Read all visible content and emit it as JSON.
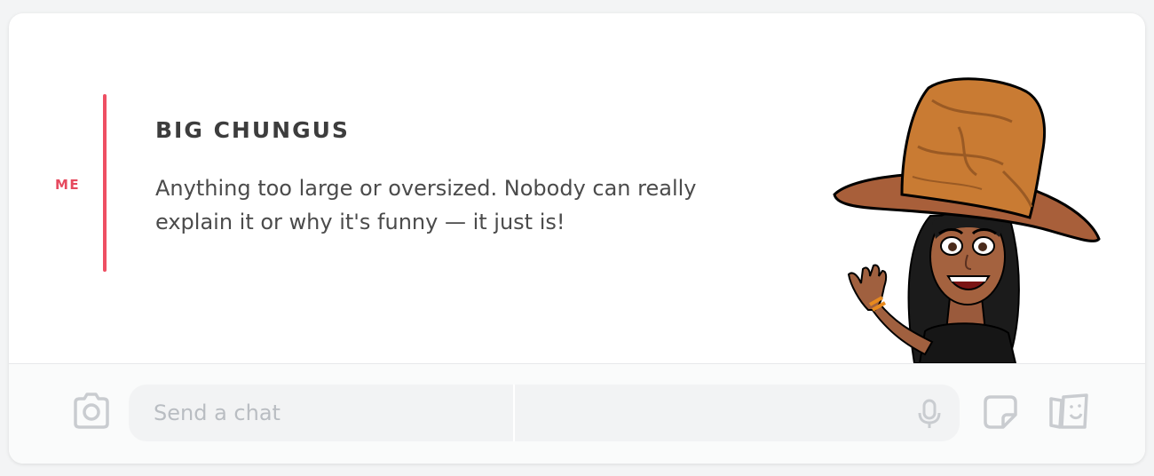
{
  "message": {
    "sender": "ME",
    "title": "BIG CHUNGUS",
    "body": "Anything too large or oversized. Nobody can really explain it or why it's funny — it just is!",
    "accent_color": "#ee4f63"
  },
  "composer": {
    "placeholder": "Send a chat",
    "icons": {
      "camera": "camera-icon",
      "mic": "microphone-icon",
      "sticker": "sticker-icon",
      "gallery": "memories-icon"
    }
  },
  "colors": {
    "sender": "#e64a5f",
    "title": "#3d3d3d",
    "icon": "#c9ccd0"
  }
}
